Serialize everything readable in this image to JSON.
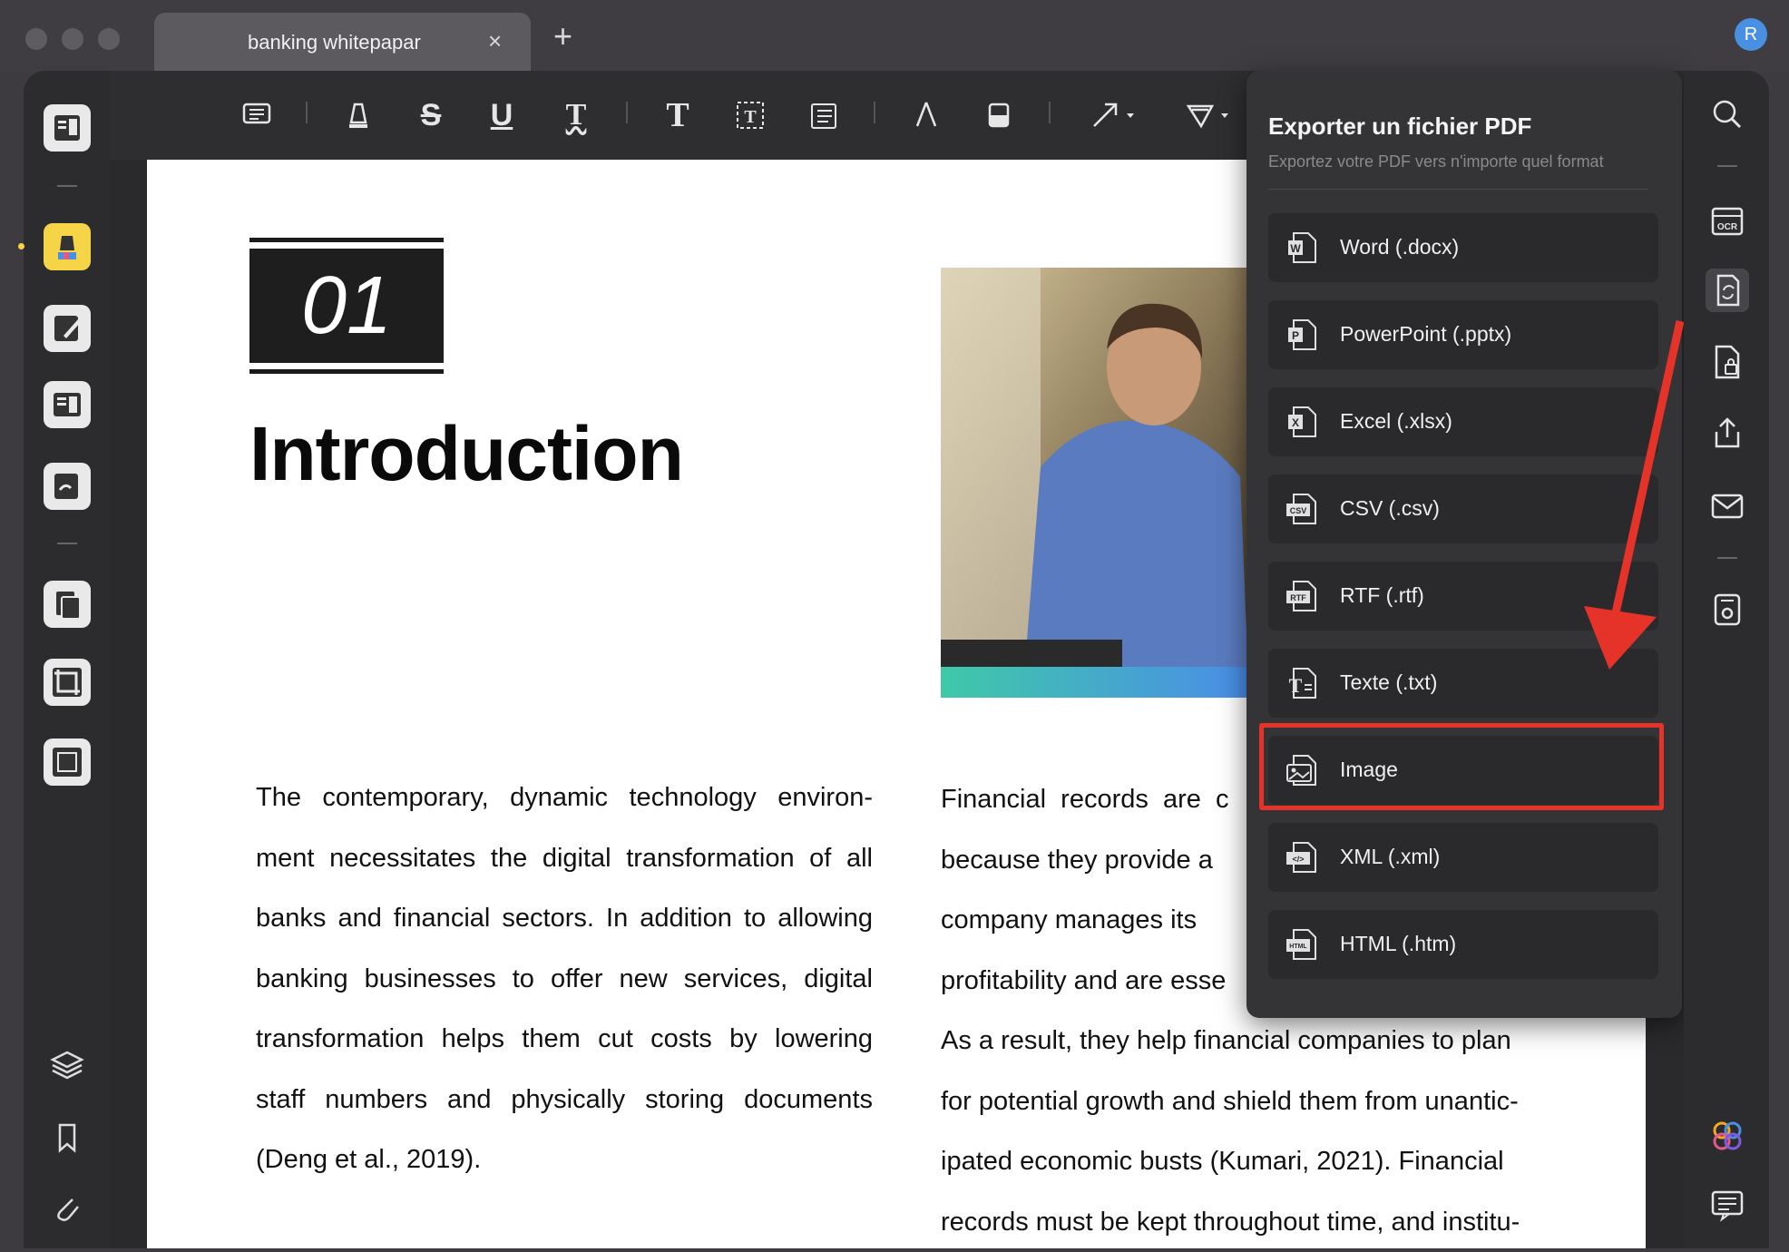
{
  "tab": {
    "title": "banking whitepapar",
    "close": "×",
    "add": "+"
  },
  "avatar": {
    "letter": "R"
  },
  "toolbar": {
    "icons": [
      "comment-icon",
      "highlighter-icon",
      "strikethrough-icon",
      "underline-icon",
      "squiggly-underline-icon",
      "text-icon",
      "textbox-icon",
      "text-callout-icon",
      "pencil-icon",
      "eraser-icon",
      "arrow-shape-icon",
      "stamp-icon"
    ]
  },
  "document": {
    "badge_number": "01",
    "heading": "Introduction",
    "left_paragraph": [
      "The contemporary, dynamic technology environ-",
      "ment necessitates the digital transformation of all",
      "banks and financial sectors. In addition to allowing",
      "banking businesses to offer new services, digital",
      "transformation helps them cut costs by lowering",
      "staff numbers and physically storing documents",
      "(Deng et al., 2019)."
    ],
    "right_paragraph": [
      "Financial  records  are  c",
      "because they provide a",
      "company  manages  its",
      "profitability and are esse",
      "As a result, they help financial companies to plan",
      "for potential growth and shield them from unantic-",
      "ipated economic busts (Kumari, 2021). Financial",
      "records must be kept throughout time, and institu-"
    ]
  },
  "export_panel": {
    "title": "Exporter un fichier PDF",
    "subtitle": "Exportez votre PDF vers n'importe quel format",
    "options": [
      {
        "label": "Word (.docx)",
        "icon": "word-file-icon",
        "tag": "W"
      },
      {
        "label": "PowerPoint (.pptx)",
        "icon": "powerpoint-file-icon",
        "tag": "P"
      },
      {
        "label": "Excel (.xlsx)",
        "icon": "excel-file-icon",
        "tag": "X"
      },
      {
        "label": "CSV (.csv)",
        "icon": "csv-file-icon",
        "tag": "CSV"
      },
      {
        "label": "RTF (.rtf)",
        "icon": "rtf-file-icon",
        "tag": "RTF"
      },
      {
        "label": "Texte (.txt)",
        "icon": "text-file-icon",
        "tag": "T"
      },
      {
        "label": "Image",
        "icon": "image-file-icon",
        "tag": ""
      },
      {
        "label": "XML (.xml)",
        "icon": "xml-file-icon",
        "tag": "</>"
      },
      {
        "label": "HTML (.htm)",
        "icon": "html-file-icon",
        "tag": "HTML"
      }
    ],
    "highlighted_option": "Image"
  },
  "colors": {
    "highlight_box": "#e5332a",
    "annotation_arrow": "#e5332a",
    "sidebar_active": "#f5d547"
  },
  "right_sidebar": {
    "ocr_label": "OCR"
  }
}
